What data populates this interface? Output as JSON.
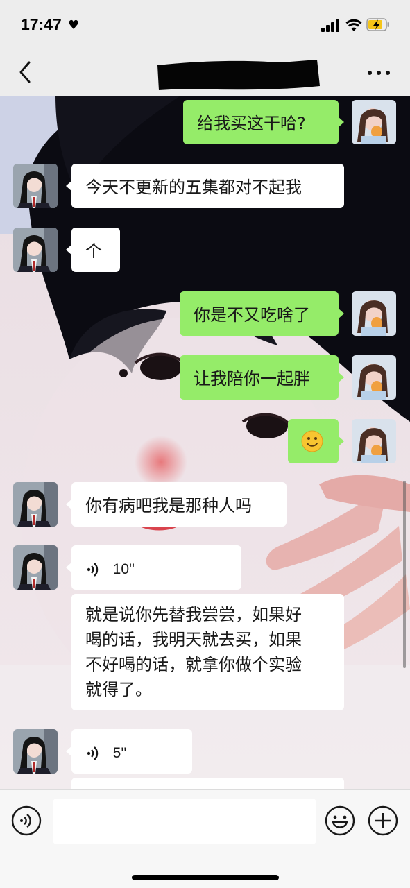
{
  "status": {
    "time": "17:47"
  },
  "header": {
    "title_redacted": true
  },
  "messages": [
    {
      "side": "right",
      "type": "text",
      "text": "给我买这干哈?"
    },
    {
      "side": "left",
      "type": "text",
      "text": "今天不更新的五集都对不起我"
    },
    {
      "side": "left",
      "type": "text",
      "text": "个"
    },
    {
      "side": "right",
      "type": "text",
      "text": "你是不又吃啥了"
    },
    {
      "side": "right",
      "type": "text",
      "text": "让我陪你一起胖"
    },
    {
      "side": "right",
      "type": "emoji",
      "text": "🙂"
    },
    {
      "side": "left",
      "type": "text",
      "text": "你有病吧我是那种人吗"
    },
    {
      "side": "left",
      "type": "voice",
      "duration": "10''"
    },
    {
      "side": "left",
      "type": "transcript",
      "lines": [
        "就是说你先替我尝尝，如果好",
        "喝的话，我明天就去买，如果",
        "不好喝的话，就拿你做个实验",
        "就得了。"
      ]
    },
    {
      "side": "left",
      "type": "voice",
      "duration": "5''"
    }
  ],
  "input": {
    "value": "",
    "placeholder": ""
  },
  "icons": {
    "back": "chevron-left-icon",
    "more": "more-dots-icon",
    "voice": "voice-mode-icon",
    "emoji": "emoji-icon",
    "plus": "plus-icon"
  },
  "colors": {
    "outgoing_bubble": "#95ec69",
    "incoming_bubble": "#ffffff",
    "bar_background": "#ededed"
  }
}
